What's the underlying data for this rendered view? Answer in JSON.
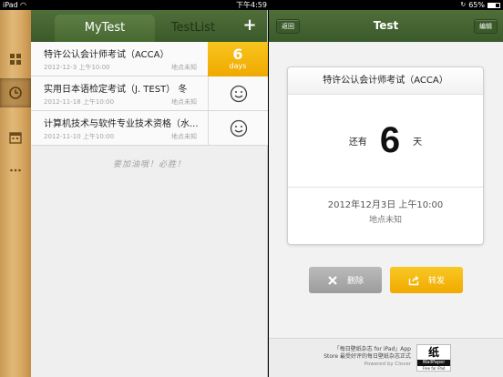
{
  "status_bar": {
    "carrier": "iPad",
    "time": "下午4:59",
    "battery": "65%"
  },
  "sidebar": {
    "items": [
      {
        "icon": "grid-icon",
        "active": false
      },
      {
        "icon": "clock-icon",
        "active": true
      },
      {
        "icon": "calendar-icon",
        "active": false
      },
      {
        "icon": "more-icon",
        "active": false
      }
    ]
  },
  "list_panel": {
    "tabs": [
      {
        "label": "MyTest",
        "active": true
      },
      {
        "label": "TestList",
        "active": false
      }
    ],
    "add_label": "+",
    "items": [
      {
        "title": "特许公认会计师考试（ACCA）",
        "date": "2012-12-3 上午10:00",
        "location": "地点未知",
        "days": "6",
        "days_unit": "days"
      },
      {
        "title": "实用日本语检定考试（J. TEST） 冬",
        "date": "2012-11-18 上午10:00",
        "location": "地点未知",
        "status_icon": "smile-icon"
      },
      {
        "title": "计算机技术与软件专业技术资格（水...",
        "date": "2012-11-10 上午10:00",
        "location": "地点未知",
        "status_icon": "smile-icon"
      }
    ],
    "cheer_text": "要加油哦！必胜！"
  },
  "detail": {
    "title": "Test",
    "back_label": "返回",
    "edit_label": "编辑",
    "card": {
      "exam_title": "特许公认会计师考试（ACCA）",
      "prefix": "还有",
      "days": "6",
      "suffix": "天",
      "datetime": "2012年12月3日 上午10:00",
      "location": "地点未知"
    },
    "delete_label": "删除",
    "share_label": "转发",
    "promo": {
      "line1": "「每日壁纸杂志 for iPad」App",
      "line2": "Store 最受好评的每日壁纸杂志正式",
      "line3": "Powered by Clover",
      "logo_glyph": "纸",
      "logo_band": "WallPaper",
      "logo_caption": "Free for iPad"
    }
  },
  "colors": {
    "header_green": "#3b5a2a",
    "accent_yellow": "#f1a900"
  }
}
